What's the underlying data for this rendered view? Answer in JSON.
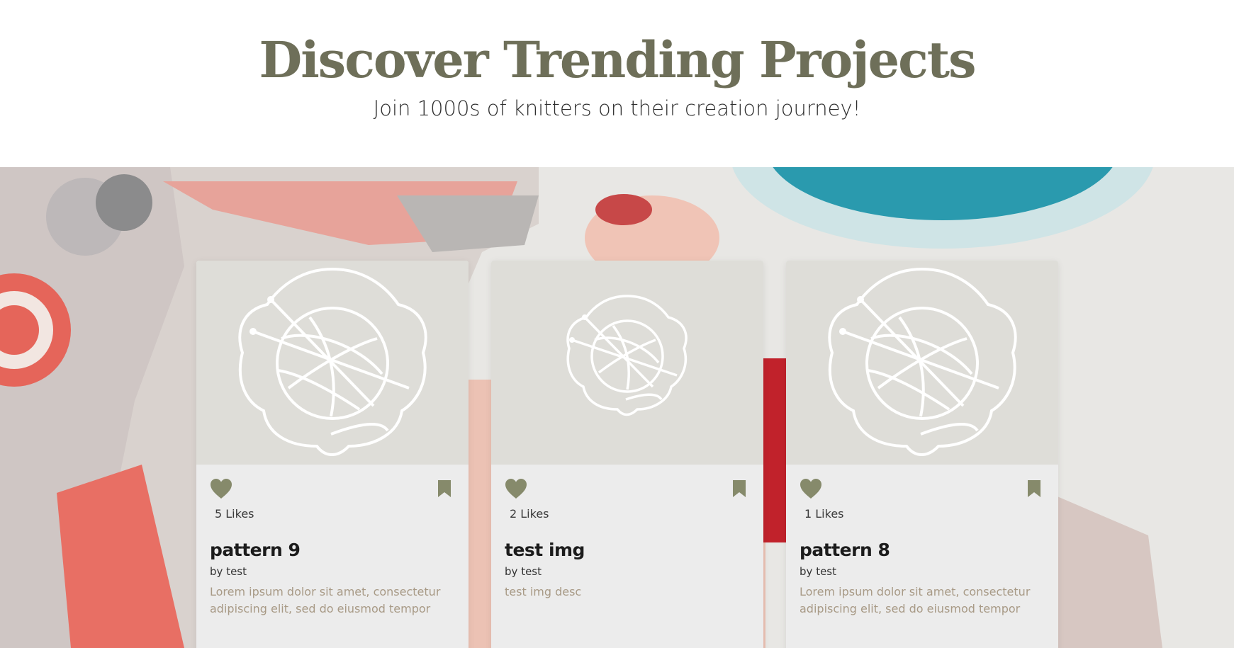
{
  "header": {
    "title": "Discover Trending Projects",
    "subtitle": "Join 1000s of knitters on their creation journey!"
  },
  "colors": {
    "title": "#6e6f59",
    "icon_accent": "#868a6b",
    "card_bg": "#ececec",
    "card_image_bg": "#deddd8",
    "description_text": "#a89a86"
  },
  "icons": {
    "like": "heart-icon",
    "save": "bookmark-icon",
    "placeholder": "yarn-ball-icon"
  },
  "cards": [
    {
      "likes_text": "5 Likes",
      "title": "pattern 9",
      "by_label": "by",
      "author": "test",
      "description": "Lorem ipsum dolor sit amet, consectetur adipiscing elit, sed do eiusmod tempor"
    },
    {
      "likes_text": "2 Likes",
      "title": "test img",
      "by_label": "by",
      "author": "test",
      "description": "test img desc"
    },
    {
      "likes_text": "1 Likes",
      "title": "pattern 8",
      "by_label": "by",
      "author": "test",
      "description": "Lorem ipsum dolor sit amet, consectetur adipiscing elit, sed do eiusmod tempor"
    }
  ]
}
